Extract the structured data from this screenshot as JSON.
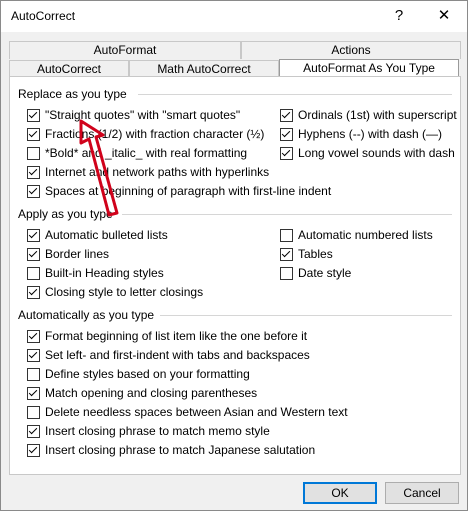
{
  "window": {
    "title": "AutoCorrect",
    "help_glyph": "?",
    "close_glyph": "✕"
  },
  "tabs": {
    "row1": [
      {
        "label": "AutoFormat"
      },
      {
        "label": "Actions"
      }
    ],
    "row2": [
      {
        "label": "AutoCorrect"
      },
      {
        "label": "Math AutoCorrect"
      },
      {
        "label": "AutoFormat As You Type",
        "active": true
      }
    ]
  },
  "replace": {
    "heading": "Replace as you type",
    "left": [
      {
        "label": "\"Straight quotes\" with \"smart quotes\"",
        "checked": true
      },
      {
        "label": "Fractions (1/2) with fraction character (½)",
        "checked": true
      },
      {
        "label": "*Bold* and _italic_ with real formatting",
        "checked": false
      },
      {
        "label": "Internet and network paths with hyperlinks",
        "checked": true
      },
      {
        "label": "Spaces at beginning of paragraph with first-line indent",
        "checked": true
      }
    ],
    "right": [
      {
        "label": "Ordinals (1st) with superscript",
        "checked": true
      },
      {
        "label": "Hyphens (--) with dash (—)",
        "checked": true
      },
      {
        "label": "Long vowel sounds with dash",
        "checked": true
      }
    ]
  },
  "apply": {
    "heading": "Apply as you type",
    "left": [
      {
        "label": "Automatic bulleted lists",
        "checked": true
      },
      {
        "label": "Border lines",
        "checked": true
      },
      {
        "label": "Built-in Heading styles",
        "checked": false
      },
      {
        "label": "Closing style to letter closings",
        "checked": true
      }
    ],
    "right": [
      {
        "label": "Automatic numbered lists",
        "checked": false
      },
      {
        "label": "Tables",
        "checked": true
      },
      {
        "label": "Date style",
        "checked": false
      }
    ]
  },
  "automatic": {
    "heading": "Automatically as you type",
    "items": [
      {
        "label": "Format beginning of list item like the one before it",
        "checked": true
      },
      {
        "label": "Set left- and first-indent with tabs and backspaces",
        "checked": true
      },
      {
        "label": "Define styles based on your formatting",
        "checked": false
      },
      {
        "label": "Match opening and closing parentheses",
        "checked": true
      },
      {
        "label": "Delete needless spaces between Asian and Western text",
        "checked": false
      },
      {
        "label": "Insert closing phrase to match memo style",
        "checked": true
      },
      {
        "label": "Insert closing phrase to match Japanese salutation",
        "checked": true
      }
    ]
  },
  "buttons": {
    "ok": "OK",
    "cancel": "Cancel"
  },
  "colors": {
    "annotation_arrow": "#d0021b",
    "ok_border": "#0078d7"
  }
}
